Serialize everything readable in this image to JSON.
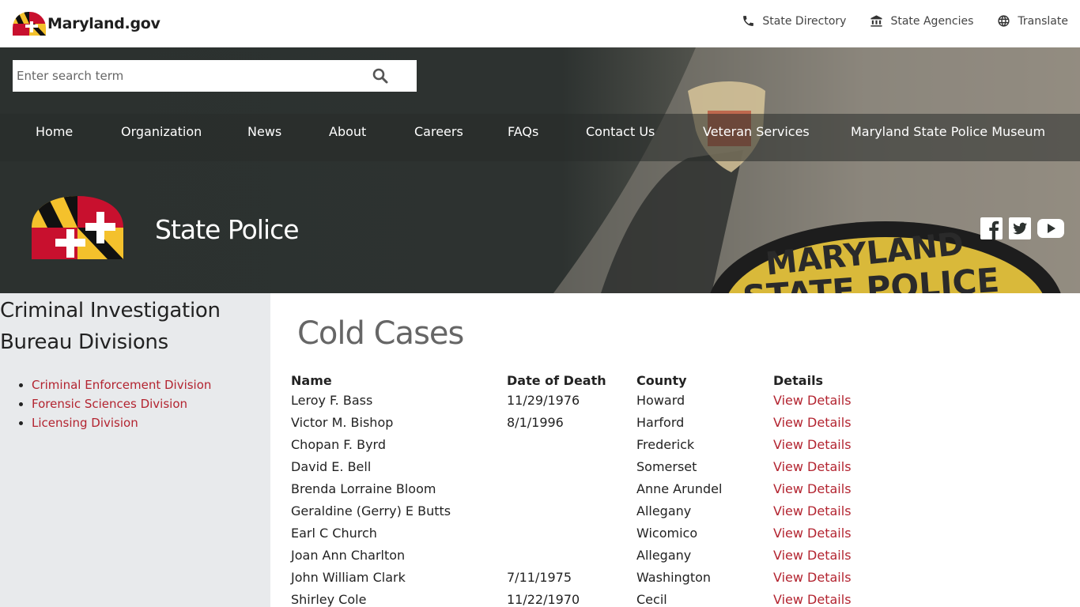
{
  "brand": {
    "name": "Maryland.gov"
  },
  "utility_links": [
    {
      "label": "State Directory",
      "icon": "phone-icon"
    },
    {
      "label": "State Agencies",
      "icon": "building-icon"
    },
    {
      "label": "Translate",
      "icon": "globe-icon"
    }
  ],
  "search": {
    "placeholder": "Enter search term",
    "icon": "search-icon"
  },
  "nav": [
    {
      "label": "Home"
    },
    {
      "label": "Organization"
    },
    {
      "label": "News"
    },
    {
      "label": "About"
    },
    {
      "label": "Careers"
    },
    {
      "label": "FAQs"
    },
    {
      "label": "Contact Us"
    },
    {
      "label": "Veteran Services"
    },
    {
      "label": "Maryland State Police Museum"
    }
  ],
  "agency": {
    "title": "State Police"
  },
  "social": [
    {
      "icon": "facebook-icon"
    },
    {
      "icon": "twitter-icon"
    },
    {
      "icon": "youtube-icon"
    }
  ],
  "sidebar": {
    "heading_line1": "Criminal Investigation",
    "heading_line2": "Bureau Divisions",
    "links": [
      {
        "label": "Criminal Enforcement Division"
      },
      {
        "label": "Forensic Sciences Division"
      },
      {
        "label": "Licensing Division"
      }
    ]
  },
  "main": {
    "title": "Cold Cases",
    "columns": [
      "Name",
      "Date of Death",
      "County",
      "Details"
    ],
    "rows": [
      {
        "name": "Leroy F. Bass",
        "date": "11/29/1976",
        "county": "Howard",
        "details": "View Details"
      },
      {
        "name": "Victor M. Bishop",
        "date": "8/1/1996",
        "county": "Harford",
        "details": "View Details"
      },
      {
        "name": "Chopan F. Byrd",
        "date": "",
        "county": "Frederick",
        "details": "View Details"
      },
      {
        "name": "David E. Bell",
        "date": "",
        "county": "Somerset",
        "details": "View Details"
      },
      {
        "name": "Brenda Lorraine Bloom",
        "date": "",
        "county": "Anne Arundel",
        "details": "View Details"
      },
      {
        "name": "Geraldine (Gerry) E Butts",
        "date": "",
        "county": "Allegany",
        "details": "View Details"
      },
      {
        "name": "Earl C Church",
        "date": "",
        "county": "Wicomico",
        "details": "View Details"
      },
      {
        "name": "Joan Ann Charlton",
        "date": "",
        "county": "Allegany",
        "details": "View Details"
      },
      {
        "name": "John William Clark",
        "date": "7/11/1975",
        "county": "Washington",
        "details": "View Details"
      },
      {
        "name": "Shirley Cole",
        "date": "11/22/1970",
        "county": "Cecil",
        "details": "View Details"
      }
    ]
  },
  "colors": {
    "link_red": "#b32430",
    "hero_dark": "#2c312f",
    "sidebar_bg": "#e8eaec"
  }
}
